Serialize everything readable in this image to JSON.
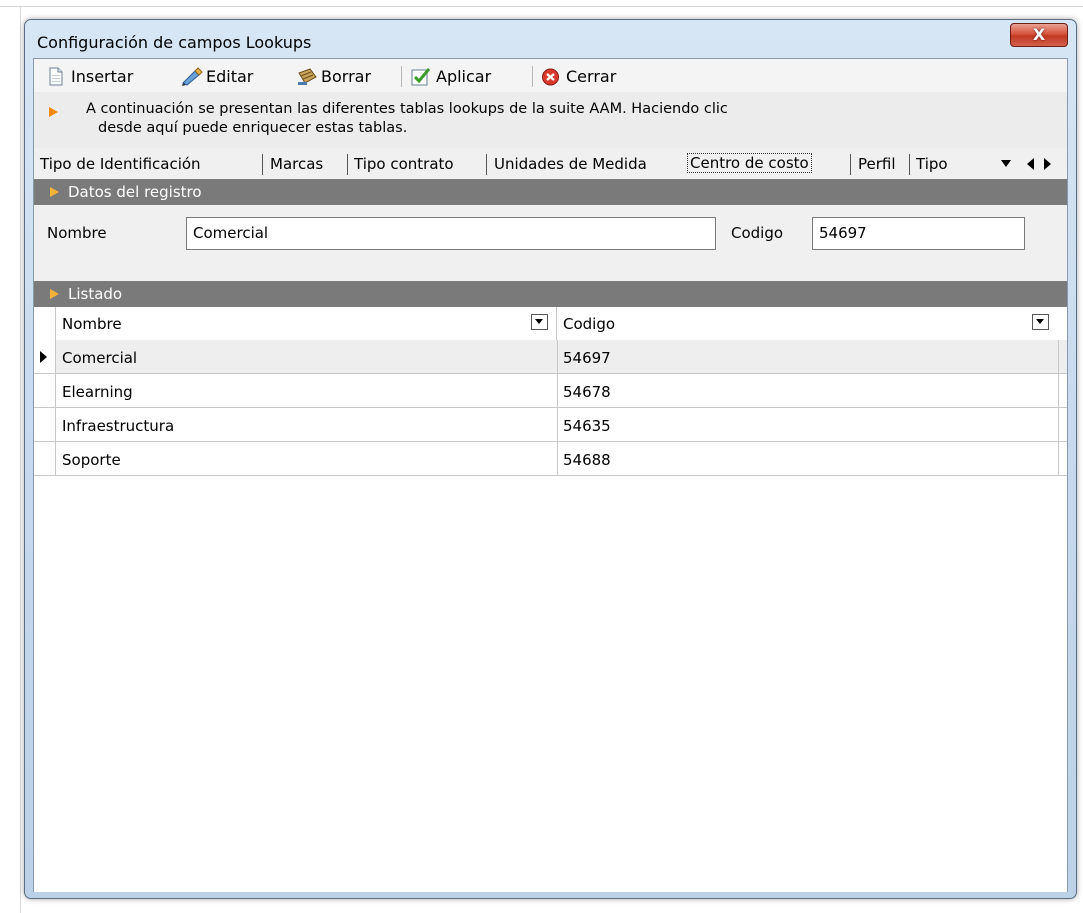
{
  "window": {
    "title": "Configuración de campos Lookups",
    "close_glyph": "X"
  },
  "toolbar": {
    "insert_label": "Insertar",
    "edit_label": "Editar",
    "delete_label": "Borrar",
    "apply_label": "Aplicar",
    "close_label": "Cerrar"
  },
  "info": {
    "line1": "A continuación se presentan las diferentes tablas lookups de la suite AAM. Haciendo clic",
    "line2": "desde aquí puede enriquecer estas tablas."
  },
  "tabs": {
    "items": [
      {
        "label": "Tipo de Identificación"
      },
      {
        "label": "Marcas"
      },
      {
        "label": "Tipo contrato"
      },
      {
        "label": "Unidades de Medida"
      },
      {
        "label": "Centro de costo"
      },
      {
        "label": "Perfil"
      },
      {
        "label": "Tipo"
      }
    ],
    "active_index": 4
  },
  "record": {
    "header": "Datos del registro",
    "name_label": "Nombre",
    "name_value": "Comercial",
    "code_label": "Codigo",
    "code_value": "54697"
  },
  "list": {
    "header": "Listado",
    "columns": [
      "Nombre",
      "Codigo"
    ],
    "rows": [
      {
        "name": "Comercial",
        "code": "54697",
        "selected": true
      },
      {
        "name": "Elearning",
        "code": "54678",
        "selected": false
      },
      {
        "name": "Infraestructura",
        "code": "54635",
        "selected": false
      },
      {
        "name": "Soporte",
        "code": "54688",
        "selected": false
      }
    ]
  },
  "colors": {
    "section_header_bg": "#7a7a7a",
    "accent_orange": "#f08a00",
    "close_button": "#c13a22"
  },
  "icons": [
    "insert-icon",
    "edit-icon",
    "delete-icon",
    "apply-icon",
    "close-icon",
    "info-arrow-icon",
    "section-arrow-icon",
    "row-indicator-icon",
    "dropdown-icon",
    "scroll-left-icon",
    "scroll-right-icon",
    "tab-overflow-icon"
  ]
}
